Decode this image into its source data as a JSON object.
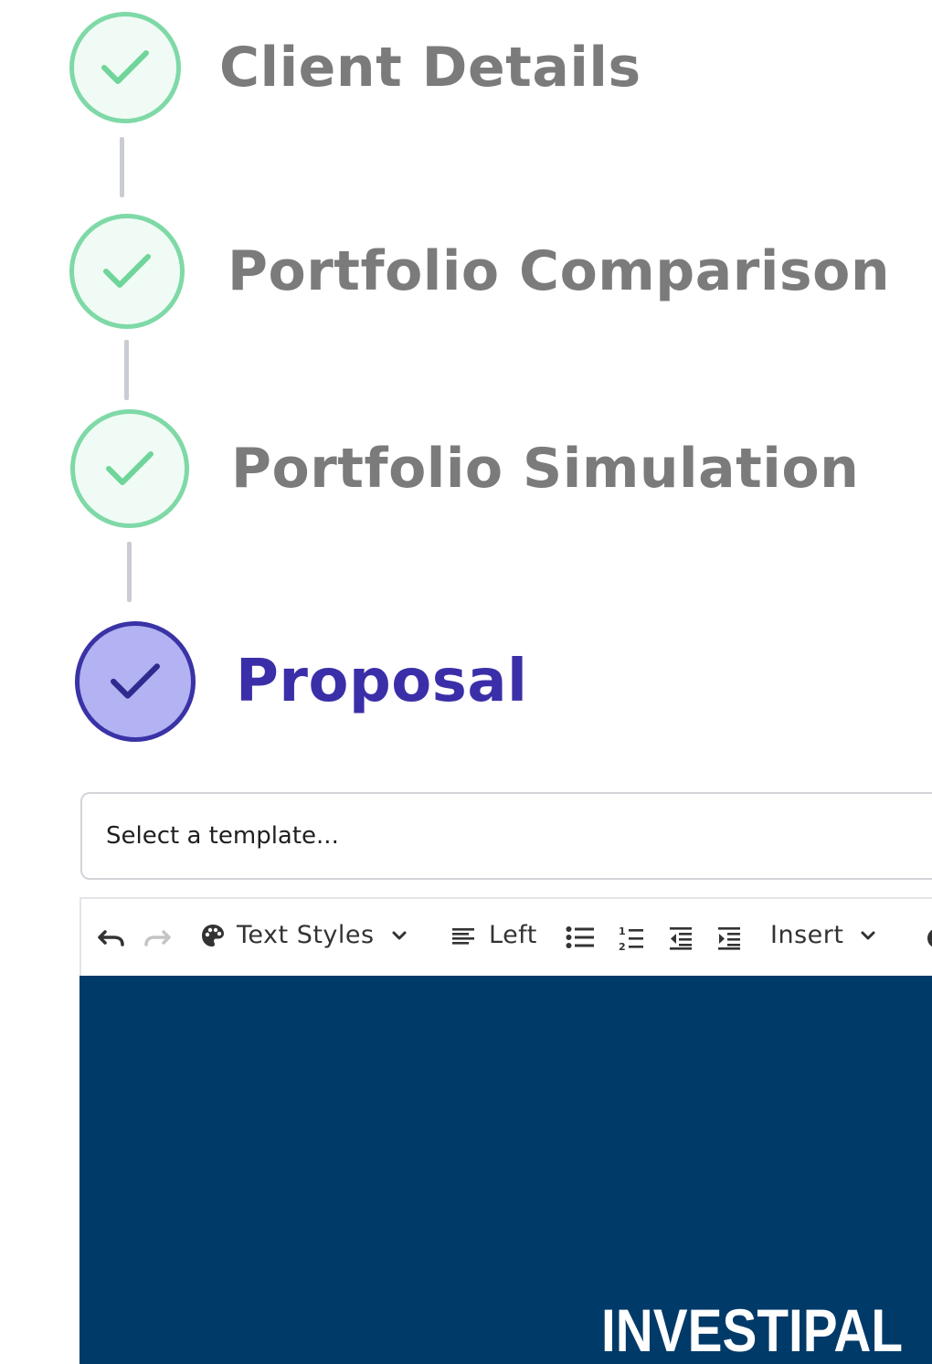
{
  "stepper": {
    "steps": [
      {
        "label": "Client Details",
        "status": "completed"
      },
      {
        "label": "Portfolio Comparison",
        "status": "completed"
      },
      {
        "label": "Portfolio Simulation",
        "status": "completed"
      },
      {
        "label": "Proposal",
        "status": "active"
      }
    ],
    "colors": {
      "completed_border": "#7ed9a6",
      "completed_check": "#6fd59a",
      "active_border": "#3a33a6",
      "active_fill": "#b3b2f2",
      "active_text": "#3a2fa8",
      "inactive_text": "#7b7b7b"
    }
  },
  "template_select": {
    "placeholder": "Select a template..."
  },
  "toolbar": {
    "undo_icon": "undo-icon",
    "redo_icon": "redo-icon",
    "text_styles_label": "Text Styles",
    "align_label": "Left",
    "insert_label": "Insert"
  },
  "canvas": {
    "background": "#003a68",
    "logo_text": "INVESTIPAL"
  }
}
